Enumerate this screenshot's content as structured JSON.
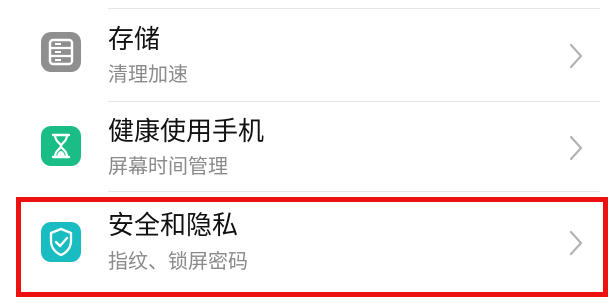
{
  "colors": {
    "storage_tile": "#8f8f8f",
    "health_tile": "#1bbd86",
    "security_tile": "#19bcc1",
    "title_text": "#111111",
    "subtitle_text": "#8a8a8a",
    "chevron": "#b3b3b3",
    "highlight_border": "#ee1111"
  },
  "settings": {
    "items": [
      {
        "title": "存储",
        "subtitle": "清理加速",
        "icon": "storage-icon"
      },
      {
        "title": "健康使用手机",
        "subtitle": "屏幕时间管理",
        "icon": "hourglass-icon"
      },
      {
        "title": "安全和隐私",
        "subtitle": "指纹、锁屏密码",
        "icon": "shield-check-icon",
        "highlighted": true
      }
    ]
  }
}
